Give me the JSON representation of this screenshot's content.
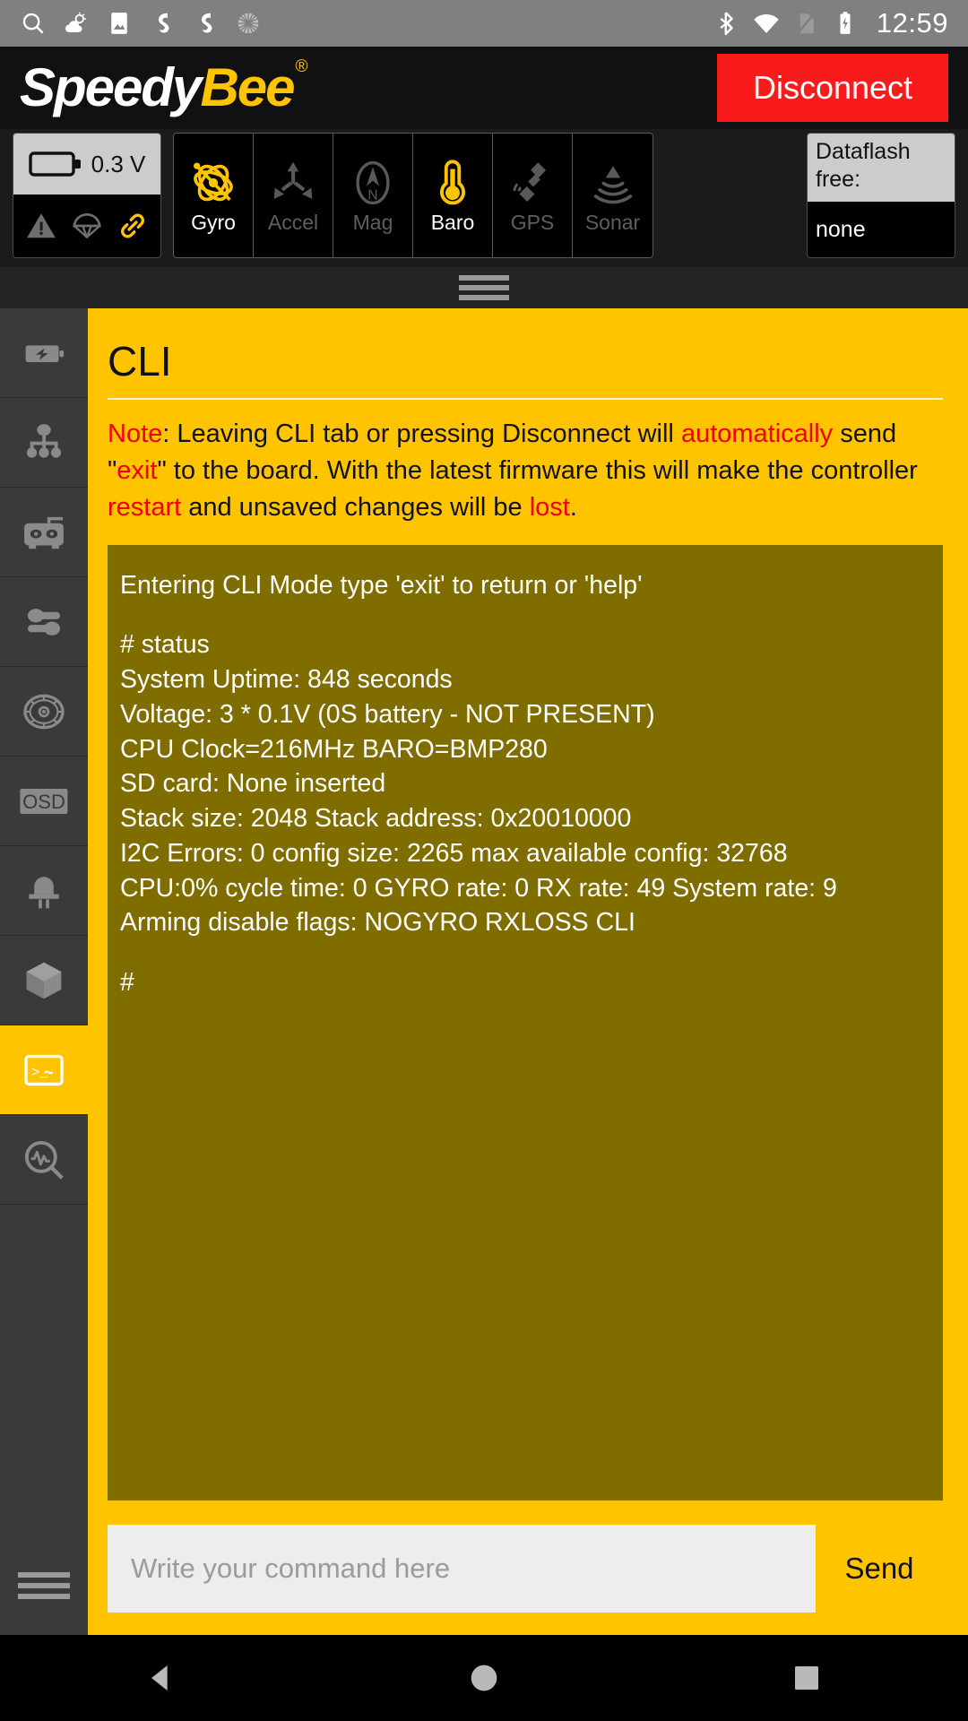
{
  "statusbar": {
    "icons": [
      "search-icon",
      "weather-icon",
      "image-icon",
      "sync-icon",
      "sync-icon-2",
      "loading-icon"
    ],
    "right_icons": [
      "bluetooth-icon",
      "wifi-off-icon",
      "sim-off-icon",
      "battery-charging-icon"
    ],
    "clock": "12:59"
  },
  "header": {
    "logo_part1": "Speedy",
    "logo_part2": "Bee",
    "logo_trademark": "®",
    "disconnect_label": "Disconnect",
    "disconnect_color": "#F91B1B"
  },
  "sensorbar": {
    "battery": {
      "voltage": "0.3 V",
      "icons": [
        "warning-triangle-icon",
        "parachute-icon",
        "link-icon"
      ]
    },
    "sensors": [
      {
        "label": "Gyro",
        "state": "on"
      },
      {
        "label": "Accel",
        "state": "off"
      },
      {
        "label": "Mag",
        "state": "off"
      },
      {
        "label": "Baro",
        "state": "on"
      },
      {
        "label": "GPS",
        "state": "off"
      },
      {
        "label": "Sonar",
        "state": "off"
      }
    ],
    "dataflash": {
      "title": "Dataflash free:",
      "value": "none"
    },
    "active_color": "#FFC400",
    "inactive_color": "#5e5e5e"
  },
  "sidebar": {
    "items": [
      {
        "name": "power-battery",
        "icon": "battery-bolt-icon",
        "active": false
      },
      {
        "name": "ports",
        "icon": "network-tree-icon",
        "active": false
      },
      {
        "name": "receiver",
        "icon": "transmitter-icon",
        "active": false
      },
      {
        "name": "modes",
        "icon": "sliders-icon",
        "active": false
      },
      {
        "name": "motors",
        "icon": "propeller-icon",
        "active": false
      },
      {
        "name": "osd",
        "icon": "osd-icon",
        "active": false
      },
      {
        "name": "leds",
        "icon": "led-icon",
        "active": false
      },
      {
        "name": "blackbox",
        "icon": "cube-icon",
        "active": false
      },
      {
        "name": "cli",
        "icon": "terminal-icon",
        "active": true
      },
      {
        "name": "sensors-analyze",
        "icon": "waveform-search-icon",
        "active": false
      }
    ]
  },
  "main": {
    "title": "CLI",
    "note": {
      "segments": [
        {
          "t": "Note",
          "red": true
        },
        {
          "t": ": Leaving CLI tab or pressing Disconnect will ",
          "red": false
        },
        {
          "t": "automatically",
          "red": true
        },
        {
          "t": " send \"",
          "red": false
        },
        {
          "t": "exit",
          "red": true
        },
        {
          "t": "\" to the board.  With the latest firmware this will make the controller ",
          "red": false
        },
        {
          "t": "restart",
          "red": true
        },
        {
          "t": " and unsaved changes will be ",
          "red": false
        },
        {
          "t": "lost",
          "red": true
        },
        {
          "t": ".",
          "red": false
        }
      ]
    },
    "console_lines": [
      "Entering CLI Mode type 'exit' to return or 'help'",
      "",
      "# status",
      "System Uptime: 848 seconds",
      "Voltage: 3 * 0.1V (0S battery - NOT PRESENT)",
      "CPU Clock=216MHz BARO=BMP280",
      "SD card: None inserted",
      "Stack size: 2048 Stack address: 0x20010000",
      "I2C Errors: 0 config size: 2265 max available config: 32768",
      "CPU:0% cycle time: 0 GYRO rate: 0 RX rate: 49 System rate: 9",
      "Arming disable flags: NOGYRO RXLOSS CLI",
      "",
      "#"
    ],
    "console_bg": "#806d00",
    "input_placeholder": "Write your command here",
    "input_value": "",
    "send_label": "Send"
  },
  "navbar": {
    "back": "back-icon",
    "home": "home-icon",
    "recents": "recents-icon"
  }
}
